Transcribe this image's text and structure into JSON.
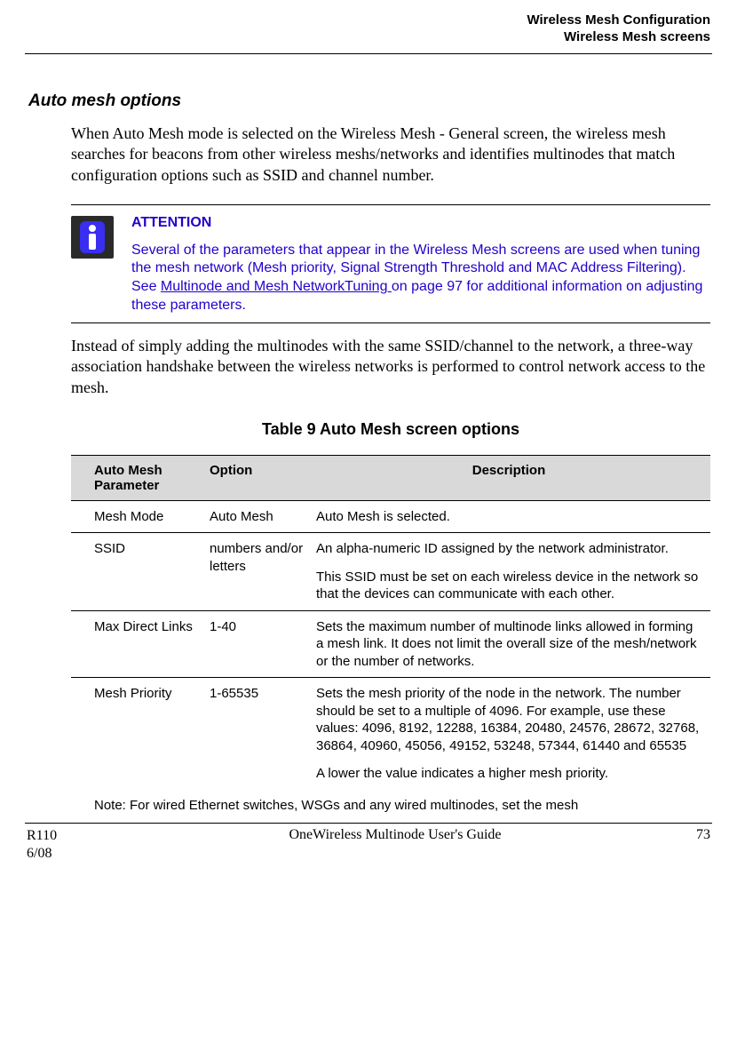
{
  "header": {
    "line1": "Wireless Mesh Configuration",
    "line2": "Wireless Mesh screens"
  },
  "section_heading": "Auto mesh options",
  "intro_para": "When Auto Mesh mode is selected on the Wireless Mesh - General screen, the wireless mesh searches for beacons from other wireless meshs/networks and identifies multinodes that match configuration options such as SSID and channel number.",
  "attention": {
    "title": "ATTENTION",
    "body_before_link": "Several of the parameters that appear in the Wireless Mesh screens are used when tuning the mesh network (Mesh priority, Signal Strength Threshold and MAC Address Filtering).  See ",
    "link_text": "Multinode and Mesh NetworkTuning ",
    "body_after_link": "on page 97 for additional information on adjusting these parameters."
  },
  "para_after_attention": "Instead of simply adding the multinodes with the same SSID/channel to the network, a three-way association handshake between the wireless networks is performed to control network access to the mesh.",
  "table": {
    "caption": "Table 9  Auto Mesh screen options",
    "headers": {
      "param": "Auto Mesh Parameter",
      "option": "Option",
      "desc": "Description"
    },
    "rows": [
      {
        "param": "Mesh Mode",
        "option": "Auto Mesh",
        "desc1": "Auto Mesh is selected.",
        "desc2": ""
      },
      {
        "param": "SSID",
        "option": "numbers and/or letters",
        "desc1": "An alpha-numeric ID assigned by the network administrator.",
        "desc2": "This SSID must be set on each wireless device in the network so that the devices can communicate with each other."
      },
      {
        "param": "Max Direct Links",
        "option": "1-40",
        "desc1": "Sets the maximum number of multinode links allowed in forming a mesh link.  It does not limit the overall size of the mesh/network or the number of networks.",
        "desc2": ""
      },
      {
        "param": "Mesh Priority",
        "option": "1-65535",
        "desc1": "Sets the mesh priority of the node in the network.  The number should be set to a multiple of 4096. For example, use these values:  4096, 8192, 12288, 16384, 20480, 24576, 28672, 32768, 36864, 40960, 45056, 49152, 53248, 57344, 61440  and 65535",
        "desc2": "A lower the value indicates a higher mesh priority."
      }
    ],
    "note": "Note:  For wired Ethernet switches, WSGs and any wired multinodes, set the mesh"
  },
  "footer": {
    "left_line1": "R110",
    "left_line2": "6/08",
    "center": "OneWireless Multinode User's Guide",
    "right": "73"
  }
}
